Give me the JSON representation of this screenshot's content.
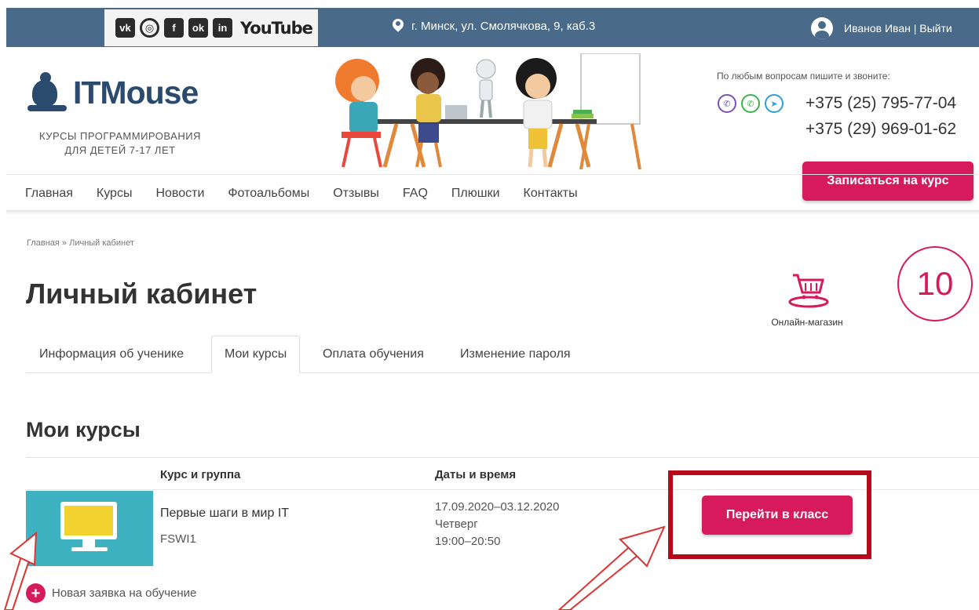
{
  "topbar": {
    "social_icons": [
      "vk-icon",
      "instagram-icon",
      "facebook-icon",
      "odnoklassniki-icon",
      "linkedin-icon"
    ],
    "social_letters": [
      "vk",
      "◎",
      "f",
      "ok",
      "in"
    ],
    "youtube": "YouTube",
    "address": "г. Минск, ул. Смолячкова, 9, каб.3",
    "user": "Иванов Иван | Выйти"
  },
  "header": {
    "logo": "ITMouse",
    "tagline_line1": "КУРСЫ ПРОГРАММИРОВАНИЯ",
    "tagline_line2": "ДЛЯ ДЕТЕЙ 7-17 ЛЕТ",
    "contact_note": "По любым вопросам пишите и звоните:",
    "phone1": "+375 (25) 795-77-04",
    "phone2": "+375 (29) 969-01-62",
    "cta": "Записаться на курс"
  },
  "nav": [
    "Главная",
    "Курсы",
    "Новости",
    "Фотоальбомы",
    "Отзывы",
    "FAQ",
    "Плюшки",
    "Контакты"
  ],
  "breadcrumb": "Главная » Личный кабинет",
  "page_title": "Личный кабинет",
  "shop_label": "Онлайн-магазин",
  "points": "10",
  "tabs": [
    "Информация об ученике",
    "Мои курсы",
    "Оплата обучения",
    "Изменение пароля"
  ],
  "section_title": "Мои курсы",
  "table": {
    "headers": [
      "Курс и группа",
      "Даты и время"
    ],
    "rows": [
      {
        "course": "Первые шаги в мир IT",
        "group": "FSWI1",
        "dates": "17.09.2020–03.12.2020",
        "day": "Четверг",
        "time": "19:00–20:50",
        "action": "Перейти в класс"
      }
    ]
  },
  "new_request": "Новая заявка на обучение",
  "colors": {
    "topbar": "#4a6a8a",
    "accent": "#d71a5c",
    "highlight": "#b50a1a",
    "logo": "#2a4a6e"
  }
}
